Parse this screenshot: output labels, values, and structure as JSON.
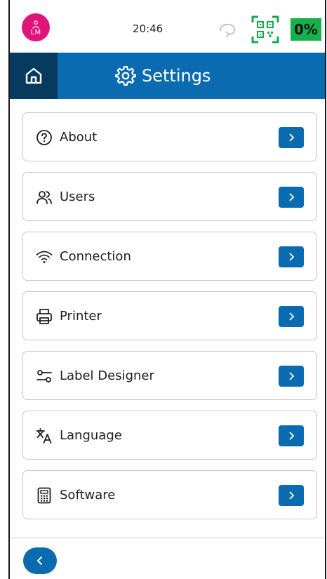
{
  "status_bar": {
    "user_initials": "LM",
    "time": "20:46",
    "battery": "0%"
  },
  "header": {
    "title": "Settings"
  },
  "menu": {
    "items": [
      {
        "label": "About",
        "icon": "help-circle-icon"
      },
      {
        "label": "Users",
        "icon": "users-icon"
      },
      {
        "label": "Connection",
        "icon": "wifi-icon"
      },
      {
        "label": "Printer",
        "icon": "printer-icon"
      },
      {
        "label": "Label Designer",
        "icon": "sliders-icon"
      },
      {
        "label": "Language",
        "icon": "translate-icon"
      },
      {
        "label": "Software",
        "icon": "calculator-icon"
      }
    ]
  },
  "colors": {
    "brand_blue": "#0a6bb0",
    "dark_blue": "#073a5f",
    "avatar_pink": "#e0147a",
    "battery_green": "#16b14b",
    "qr_green": "#1aa84a"
  }
}
